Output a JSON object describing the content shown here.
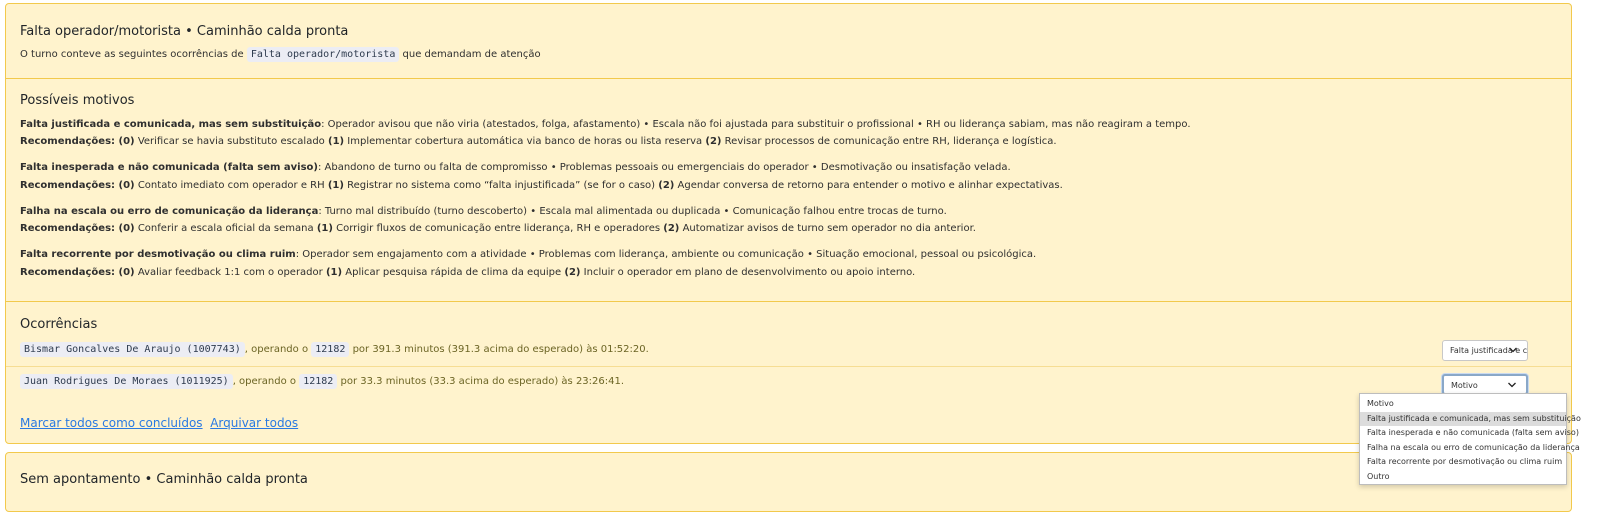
{
  "card1": {
    "title": "Falta operador/motorista • Caminhão calda pronta",
    "intro_prefix": "O turno conteve as seguintes ocorrências de",
    "intro_code": "Falta operador/motorista",
    "intro_suffix": "que demandam de atenção",
    "motives_title": "Possíveis motivos",
    "motives": [
      {
        "name": "Falta justificada e comunicada, mas sem substituição",
        "desc": ": Operador avisou que não viria (atestados, folga, afastamento) • Escala não foi ajustada para substituir o profissional • RH ou liderança sabiam, mas não reagiram a tempo.",
        "rec_label": "Recomendações",
        "recs": [
          {
            "n": "(0)",
            "t": "Verificar se havia substituto escalado"
          },
          {
            "n": "(1)",
            "t": "Implementar cobertura automática via banco de horas ou lista reserva"
          },
          {
            "n": "(2)",
            "t": "Revisar processos de comunicação entre RH, liderança e logística."
          }
        ]
      },
      {
        "name": "Falta inesperada e não comunicada (falta sem aviso)",
        "desc": ": Abandono de turno ou falta de compromisso • Problemas pessoais ou emergenciais do operador • Desmotivação ou insatisfação velada.",
        "rec_label": "Recomendações",
        "recs": [
          {
            "n": "(0)",
            "t": "Contato imediato com operador e RH"
          },
          {
            "n": "(1)",
            "t": "Registrar no sistema como “falta injustificada” (se for o caso)"
          },
          {
            "n": "(2)",
            "t": "Agendar conversa de retorno para entender o motivo e alinhar expectativas."
          }
        ]
      },
      {
        "name": "Falha na escala ou erro de comunicação da liderança",
        "desc": ": Turno mal distribuído (turno descoberto) • Escala mal alimentada ou duplicada • Comunicação falhou entre trocas de turno.",
        "rec_label": "Recomendações",
        "recs": [
          {
            "n": "(0)",
            "t": "Conferir a escala oficial da semana"
          },
          {
            "n": "(1)",
            "t": "Corrigir fluxos de comunicação entre liderança, RH e operadores"
          },
          {
            "n": "(2)",
            "t": "Automatizar avisos de turno sem operador no dia anterior."
          }
        ]
      },
      {
        "name": "Falta recorrente por desmotivação ou clima ruim",
        "desc": ": Operador sem engajamento com a atividade • Problemas com liderança, ambiente ou comunicação • Situação emocional, pessoal ou psicológica.",
        "rec_label": "Recomendações",
        "recs": [
          {
            "n": "(0)",
            "t": "Avaliar feedback 1:1 com o operador"
          },
          {
            "n": "(1)",
            "t": "Aplicar pesquisa rápida de clima da equipe"
          },
          {
            "n": "(2)",
            "t": "Incluir o operador em plano de desenvolvimento ou apoio interno."
          }
        ]
      }
    ],
    "occurrences_title": "Ocorrências",
    "occurrences": [
      {
        "operator": "Bismar Goncalves De Araujo (1007743)",
        "operating_text": ", operando o",
        "vehicle": "12182",
        "detail": "por 391.3 minutos (391.3 acima do esperado) às 01:52:20.",
        "select_value": "Falta justificada e comunicada, mas sem substituição"
      },
      {
        "operator": "Juan Rodrigues De Moraes (1011925)",
        "operating_text": ", operando o",
        "vehicle": "12182",
        "detail": "por 33.3 minutos (33.3 acima do esperado) às 23:26:41.",
        "select_value": "Motivo"
      }
    ],
    "mark_all_link": "Marcar todos como concluídos",
    "archive_all_link": "Arquivar todos"
  },
  "card2": {
    "title": "Sem apontamento • Caminhão calda pronta"
  },
  "dropdown": {
    "options": [
      "Motivo",
      "Falta justificada e comunicada, mas sem substituição",
      "Falta inesperada e não comunicada (falta sem aviso)",
      "Falha na escala ou erro de comunicação da liderança",
      "Falta recorrente por desmotivação ou clima ruim",
      "Outro"
    ],
    "highlighted_index": 1
  },
  "colors": {
    "card_bg": "#fff3cd",
    "card_border": "#f2c94c",
    "link": "#2a7ae2",
    "olive_text": "#6b6424"
  },
  "icons": {
    "select_chevron": "chevron-down-icon"
  }
}
